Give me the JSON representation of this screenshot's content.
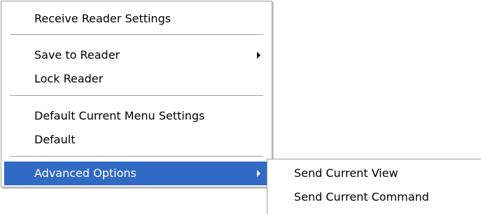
{
  "main_menu": {
    "items": [
      {
        "label": "Receive Reader Settings"
      },
      {
        "label": "Save to Reader"
      },
      {
        "label": "Lock Reader"
      },
      {
        "label": "Default Current Menu Settings"
      },
      {
        "label": "Default"
      },
      {
        "label": "Advanced Options"
      }
    ],
    "submenu_arrow_icon": "chevron-right-icon",
    "selected_item": "Advanced Options"
  },
  "sub_menu": {
    "items": [
      {
        "label": "Send Current View"
      },
      {
        "label": "Send Current Command"
      }
    ]
  },
  "colors": {
    "highlight_bg": "#316ac5",
    "highlight_text": "#ffffff",
    "separator": "#a0a0a0"
  }
}
